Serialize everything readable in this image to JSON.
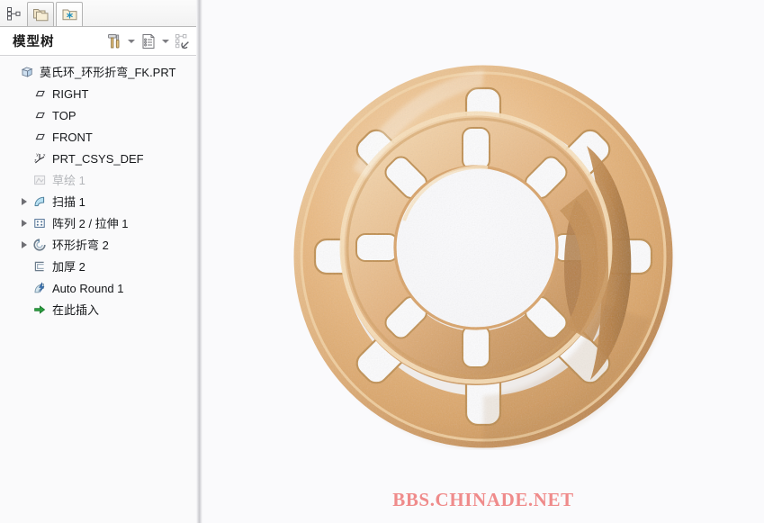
{
  "window": {
    "background": "#fafafc"
  },
  "tabstrip": {
    "tree_toggle_icon": "tree-structure-icon",
    "tabs": [
      {
        "id": "tab-folders",
        "icon": "stacked-folders-icon",
        "label": "",
        "active": false
      },
      {
        "id": "tab-favorites",
        "icon": "folder-star-icon",
        "label": "",
        "active": true
      }
    ]
  },
  "panel": {
    "title": "模型树",
    "tools": [
      {
        "id": "settings-tools",
        "icon": "hammer-screwdriver-icon",
        "has_caret": true
      },
      {
        "id": "display-list",
        "icon": "list-document-icon",
        "has_caret": true
      },
      {
        "id": "tree-filter",
        "icon": "tree-filter-icon",
        "has_caret": false
      }
    ]
  },
  "tree": {
    "nodes": [
      {
        "label": "莫氏环_环形折弯_FK.PRT",
        "icon": "part-cube-icon",
        "indent": 0,
        "expandable": false,
        "dim": false
      },
      {
        "label": "RIGHT",
        "icon": "datum-plane-icon",
        "indent": 1,
        "expandable": false,
        "dim": false
      },
      {
        "label": "TOP",
        "icon": "datum-plane-icon",
        "indent": 1,
        "expandable": false,
        "dim": false
      },
      {
        "label": "FRONT",
        "icon": "datum-plane-icon",
        "indent": 1,
        "expandable": false,
        "dim": false
      },
      {
        "label": "PRT_CSYS_DEF",
        "icon": "coordinate-system-icon",
        "indent": 1,
        "expandable": false,
        "dim": false
      },
      {
        "label": "草绘 1",
        "icon": "sketch-icon",
        "indent": 1,
        "expandable": false,
        "dim": true
      },
      {
        "label": "扫描 1",
        "icon": "sweep-icon",
        "indent": 1,
        "expandable": true,
        "dim": false
      },
      {
        "label": "阵列 2 / 拉伸 1",
        "icon": "pattern-icon",
        "indent": 1,
        "expandable": true,
        "dim": false
      },
      {
        "label": "环形折弯 2",
        "icon": "toroidal-bend-icon",
        "indent": 1,
        "expandable": true,
        "dim": false
      },
      {
        "label": "加厚 2",
        "icon": "thicken-icon",
        "indent": 1,
        "expandable": false,
        "dim": false
      },
      {
        "label": "Auto Round 1",
        "icon": "auto-round-icon",
        "indent": 1,
        "expandable": false,
        "dim": false
      },
      {
        "label": "在此插入",
        "icon": "insert-here-arrow-icon",
        "indent": 1,
        "expandable": false,
        "dim": false
      }
    ]
  },
  "viewport": {
    "model_name": "toroidal-bent-slotted-ring",
    "material_color": "#e0a96d",
    "material_highlight": "#f5d3a6",
    "material_shadow": "#b07c42",
    "background": "#fafafc"
  },
  "watermark": {
    "text": "BBS.CHINADE.NET",
    "color": "#ef8b8b"
  }
}
